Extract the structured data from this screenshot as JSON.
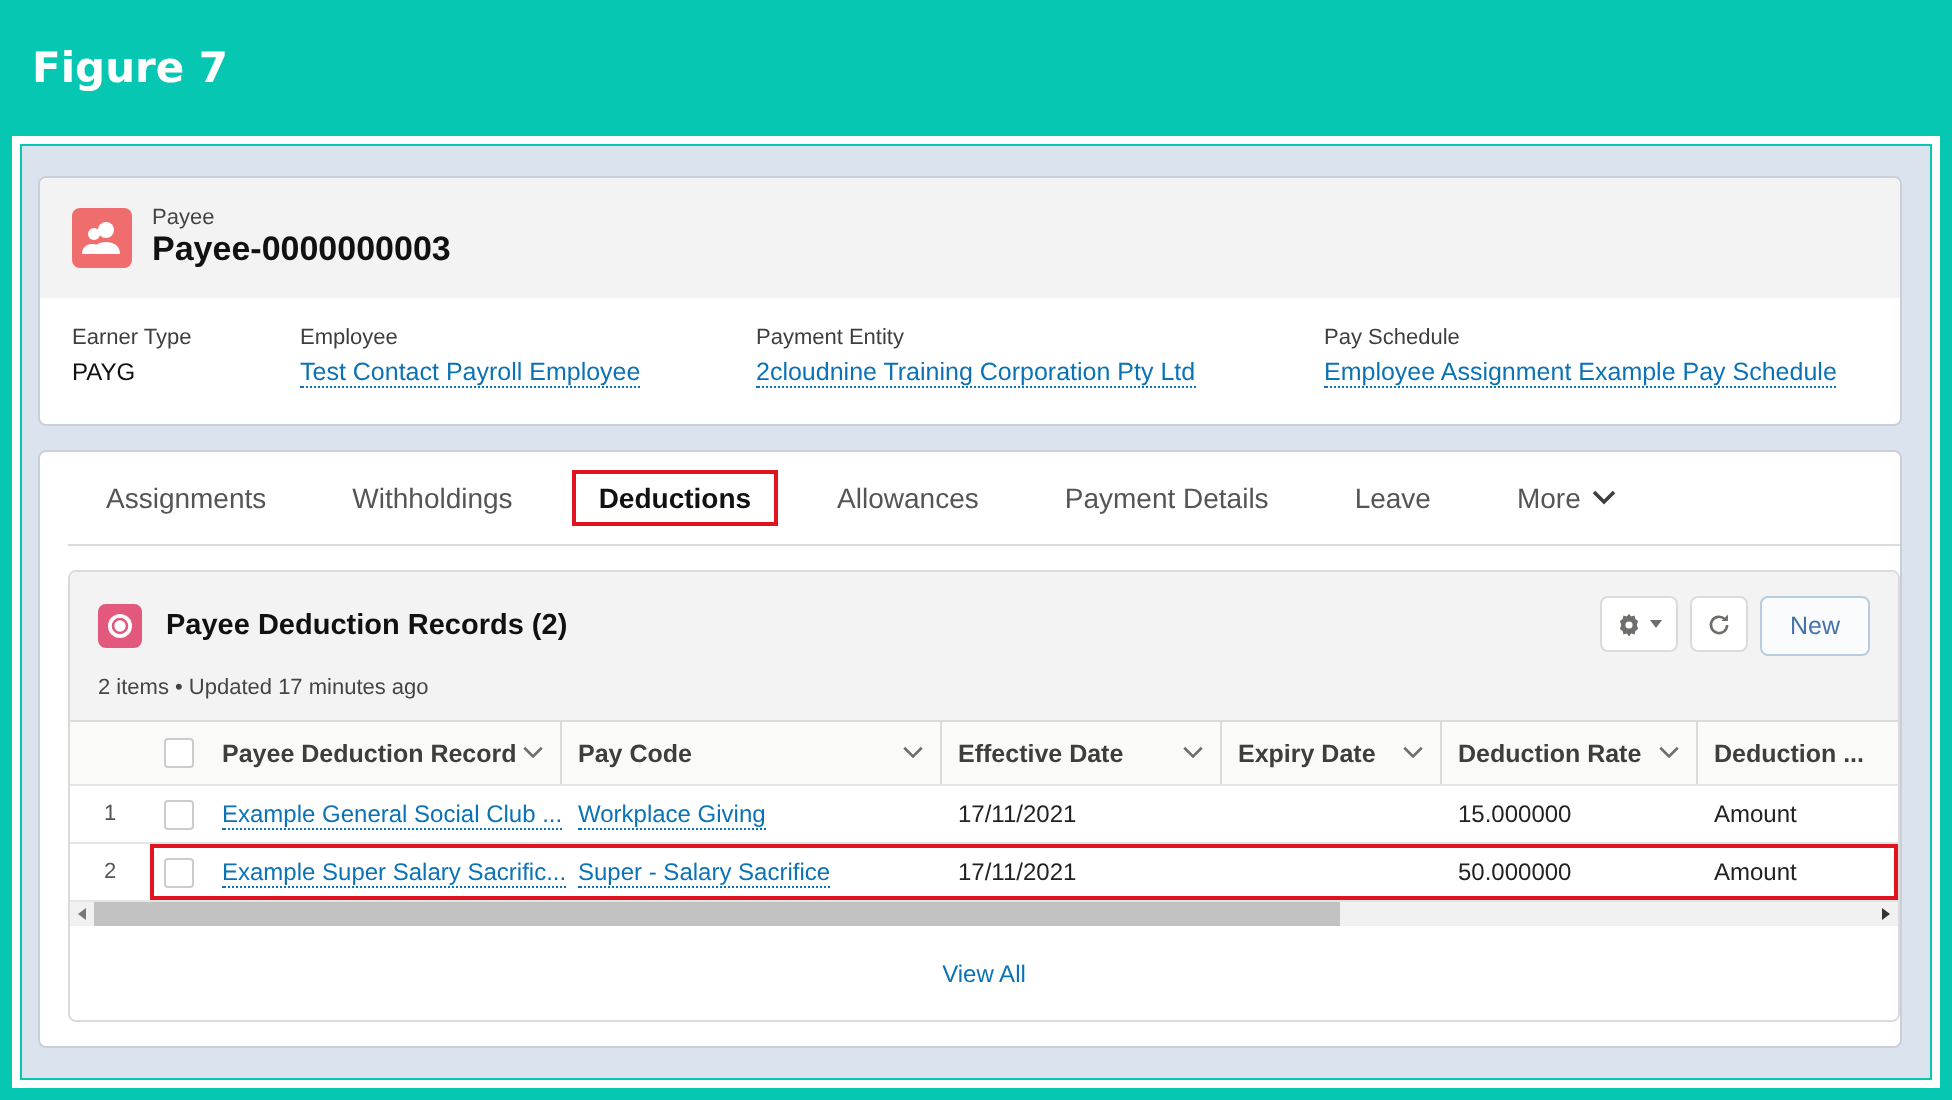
{
  "figure_title": "Figure 7",
  "record": {
    "object_label": "Payee",
    "name": "Payee-0000000003",
    "fields": [
      {
        "label": "Earner Type",
        "value": "PAYG",
        "kind": "text"
      },
      {
        "label": "Employee",
        "value": "Test Contact Payroll Employee",
        "kind": "link"
      },
      {
        "label": "Payment Entity",
        "value": "2cloudnine Training Corporation Pty Ltd",
        "kind": "link"
      },
      {
        "label": "Pay Schedule",
        "value": "Employee Assignment Example Pay Schedule",
        "kind": "link"
      }
    ]
  },
  "tabs": [
    {
      "label": "Assignments",
      "selected": false,
      "kind": "tab"
    },
    {
      "label": "Withholdings",
      "selected": false,
      "kind": "tab"
    },
    {
      "label": "Deductions",
      "selected": true,
      "kind": "tab"
    },
    {
      "label": "Allowances",
      "selected": false,
      "kind": "tab"
    },
    {
      "label": "Payment Details",
      "selected": false,
      "kind": "tab"
    },
    {
      "label": "Leave",
      "selected": false,
      "kind": "tab"
    },
    {
      "label": "More",
      "selected": false,
      "kind": "menu"
    }
  ],
  "related_list": {
    "title": "Payee Deduction Records (2)",
    "subtitle": "2 items • Updated 17 minutes ago",
    "new_button": "New",
    "all_checked": false,
    "columns": [
      {
        "label": "Payee Deduction Record",
        "kind": "link",
        "sort_menu": true
      },
      {
        "label": "Pay Code",
        "kind": "link",
        "sort_menu": true
      },
      {
        "label": "Effective Date",
        "kind": "text",
        "sort_menu": true
      },
      {
        "label": "Expiry Date",
        "kind": "text",
        "sort_menu": true
      },
      {
        "label": "Deduction Rate",
        "kind": "text",
        "sort_menu": true
      },
      {
        "label": "Deduction ...",
        "kind": "text",
        "sort_menu": false
      }
    ],
    "rows": [
      {
        "number": "1",
        "checked": false,
        "highlighted": false,
        "cells": [
          "Example General Social Club ...",
          "Workplace Giving",
          "17/11/2021",
          "",
          "15.000000",
          "Amount"
        ]
      },
      {
        "number": "2",
        "checked": false,
        "highlighted": true,
        "cells": [
          "Example Super Salary Sacrific...",
          "Super - Salary Sacrifice",
          "17/11/2021",
          "",
          "50.000000",
          "Amount"
        ]
      }
    ],
    "footer_link": "View All"
  }
}
